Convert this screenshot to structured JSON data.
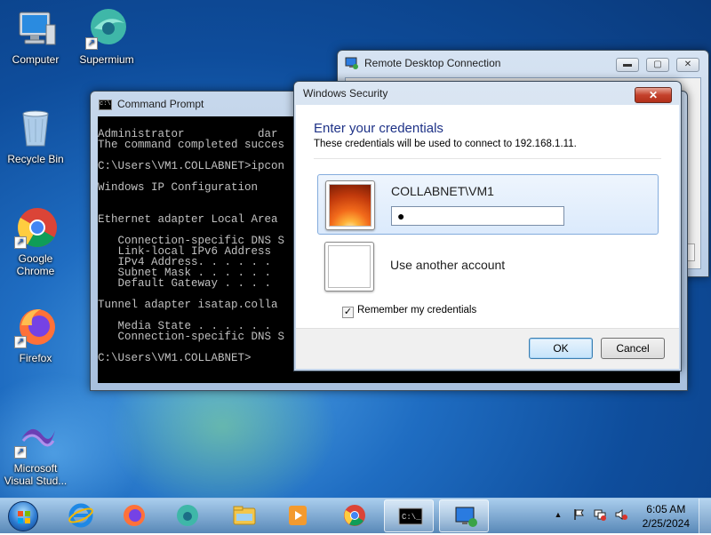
{
  "desktop": {
    "icons": [
      {
        "label": "Computer"
      },
      {
        "label": "Supermium"
      },
      {
        "label": "Recycle Bin"
      },
      {
        "label": "Google Chrome"
      },
      {
        "label": "Firefox"
      },
      {
        "label": "Microsoft Visual Stud..."
      }
    ]
  },
  "rdc": {
    "title": "Remote Desktop Connection",
    "minimize": "▬",
    "maximize": "▢",
    "close": "✕"
  },
  "cmd": {
    "title": "Command Prompt",
    "lines": [
      "",
      "Administrator           dar",
      "The command completed succes",
      "",
      "C:\\Users\\VM1.COLLABNET>ipcon",
      "",
      "Windows IP Configuration",
      "",
      "",
      "Ethernet adapter Local Area",
      "",
      "   Connection-specific DNS S",
      "   Link-local IPv6 Address",
      "   IPv4 Address. . . . . .",
      "   Subnet Mask . . . . . .",
      "   Default Gateway . . . .",
      "",
      "Tunnel adapter isatap.colla",
      "",
      "   Media State . . . . . .",
      "   Connection-specific DNS S",
      "",
      "C:\\Users\\VM1.COLLABNET>"
    ]
  },
  "security": {
    "title": "Windows Security",
    "close": "✕",
    "heading": "Enter your credentials",
    "subtext": "These credentials will be used to connect to 192.168.1.11.",
    "account": {
      "username": "COLLABNET\\VM1",
      "password_value": "●"
    },
    "other_account": "Use another account",
    "remember": {
      "label": "Remember my credentials",
      "checked_mark": "✓"
    },
    "ok": "OK",
    "cancel": "Cancel"
  },
  "taskbar": {
    "apps": [
      "Internet Explorer",
      "Firefox",
      "Supermium",
      "File Explorer",
      "Media Player",
      "Google Chrome",
      "Command Prompt",
      "Remote Desktop Connection"
    ],
    "tray": {
      "up_arrow": "▲"
    },
    "time": "6:05 AM",
    "date": "2/25/2024"
  },
  "colors": {
    "desktop_bg": "#1f6dc2",
    "dialog_heading": "#1e3287",
    "close_red": "#c4412c"
  }
}
